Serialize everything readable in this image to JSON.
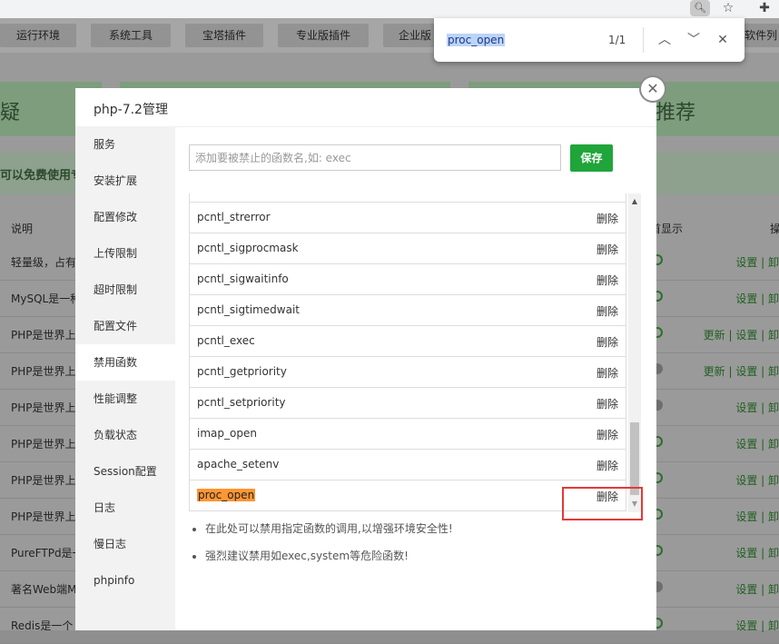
{
  "browser": {
    "toolbar_icons": [
      "search-icon",
      "star-icon",
      "extensions-icon"
    ]
  },
  "background_app": {
    "tabs": [
      "运行环境",
      "系统工具",
      "宝塔插件",
      "专业版插件",
      "企业版",
      "软件列"
    ],
    "cards": [
      "疑",
      "推荐"
    ],
    "banner": "可以免费使用专",
    "table_headers": [
      "说明",
      "首显示",
      "操"
    ],
    "rows": [
      {
        "desc": "轻量级，占有",
        "actions": "设置 | 卸",
        "toggle": "on"
      },
      {
        "desc": "MySQL是一种",
        "actions": "设置 | 卸",
        "toggle": "on"
      },
      {
        "desc": "PHP是世界上",
        "actions": "更新 | 设置 | 卸",
        "toggle": "on"
      },
      {
        "desc": "PHP是世界上",
        "actions": "更新 | 设置 | 卸",
        "toggle": "off"
      },
      {
        "desc": "PHP是世界上",
        "actions": "设置 | 卸",
        "toggle": "off"
      },
      {
        "desc": "PHP是世界上",
        "actions": "设置 | 卸",
        "toggle": "on"
      },
      {
        "desc": "PHP是世界上",
        "actions": "设置 | 卸",
        "toggle": "on"
      },
      {
        "desc": "PHP是世界上",
        "actions": "设置 | 卸",
        "toggle": "on"
      },
      {
        "desc": "PureFTPd是一",
        "actions": "设置 | 卸",
        "toggle": "on"
      },
      {
        "desc": "著名Web端M",
        "actions": "设置 | 卸",
        "toggle": "off"
      },
      {
        "desc": "Redis是一个",
        "actions": "设置 | 卸",
        "toggle": "on"
      }
    ]
  },
  "findbar": {
    "query": "proc_open",
    "count": "1/1",
    "icons": [
      "chevron-up-icon",
      "chevron-down-icon",
      "close-icon"
    ]
  },
  "modal": {
    "title": "php-7.2管理",
    "close_icon": "close-icon",
    "sidebar": [
      "服务",
      "安装扩展",
      "配置修改",
      "上传限制",
      "超时限制",
      "配置文件",
      "禁用函数",
      "性能调整",
      "负载状态",
      "Session配置",
      "日志",
      "慢日志",
      "phpinfo"
    ],
    "active_item": "禁用函数",
    "input_placeholder": "添加要被禁止的函数名,如: exec",
    "save_label": "保存",
    "delete_label": "删除",
    "functions": [
      "pcntl_strerror",
      "pcntl_sigprocmask",
      "pcntl_sigwaitinfo",
      "pcntl_sigtimedwait",
      "pcntl_exec",
      "pcntl_getpriority",
      "pcntl_setpriority",
      "imap_open",
      "apache_setenv",
      "proc_open"
    ],
    "highlighted_function": "proc_open",
    "tips": [
      "在此处可以禁用指定函数的调用,以增强环境安全性!",
      "强烈建议禁用如exec,system等危险函数!"
    ]
  },
  "colors": {
    "primary_green": "#20a53a",
    "find_highlight": "#ff9632",
    "annotation_red": "#e53935"
  }
}
